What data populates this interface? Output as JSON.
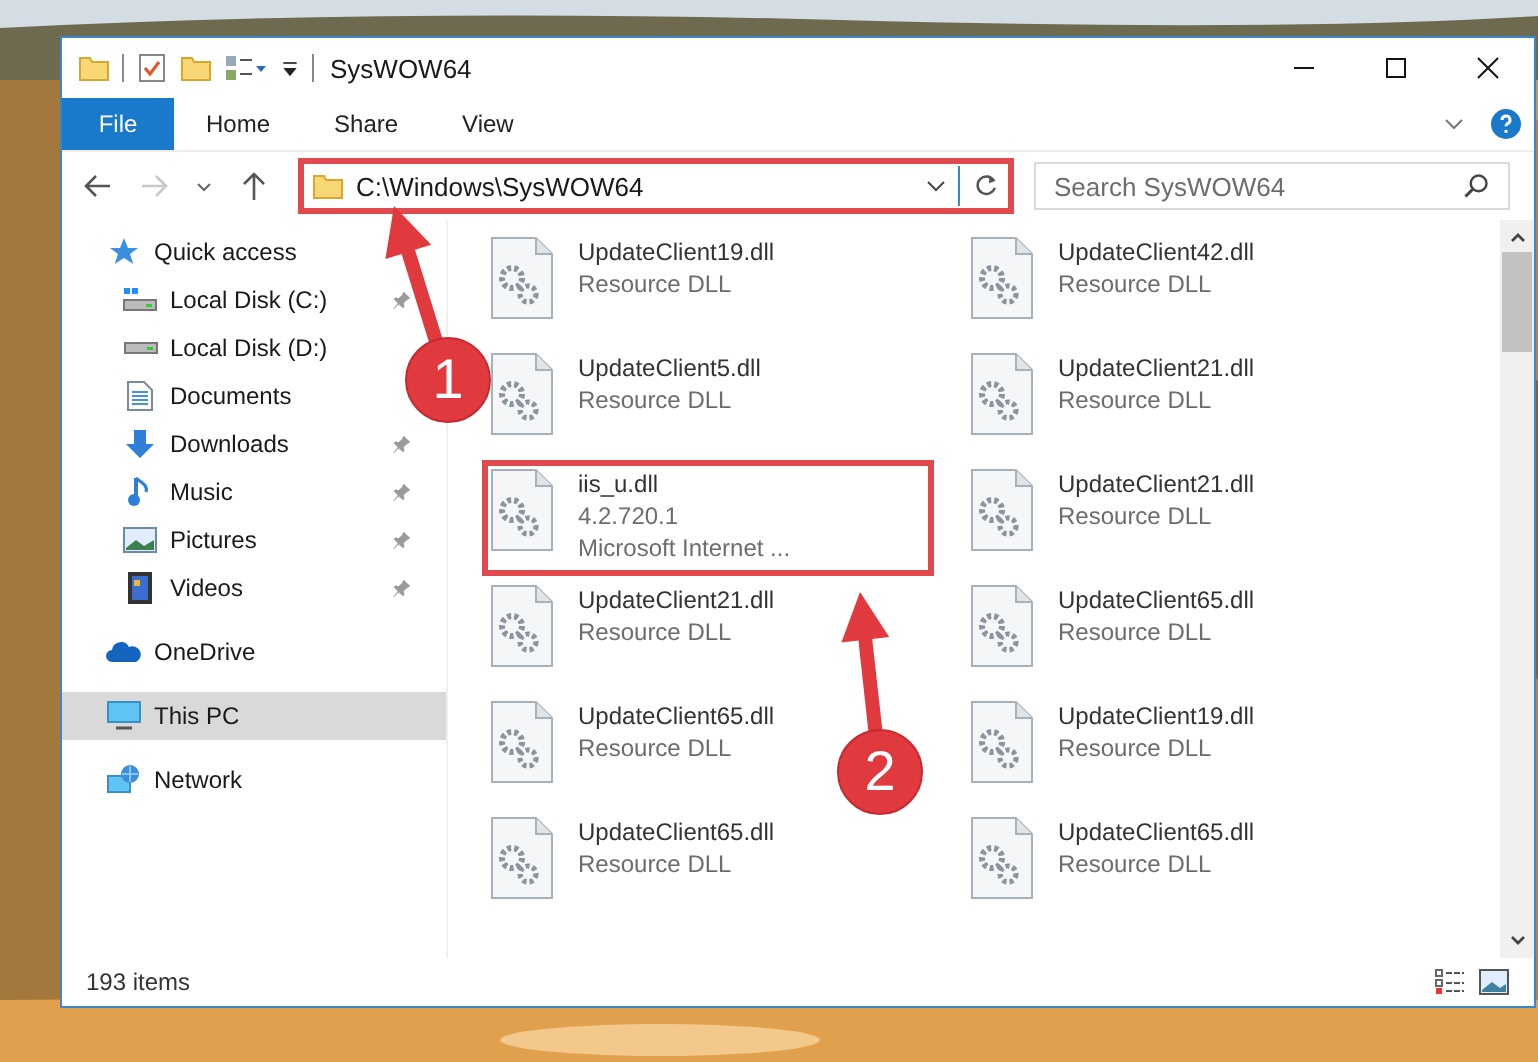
{
  "window": {
    "title": "SysWOW64"
  },
  "ribbon_tabs": [
    {
      "label": "File",
      "kind": "file"
    },
    {
      "label": "Home",
      "kind": "tab"
    },
    {
      "label": "Share",
      "kind": "tab"
    },
    {
      "label": "View",
      "kind": "tab"
    }
  ],
  "address_bar": {
    "path": "C:\\Windows\\SysWOW64",
    "highlighted": true
  },
  "search": {
    "placeholder": "Search SysWOW64"
  },
  "sidebar": {
    "items": [
      {
        "label": "Quick access",
        "selected": false,
        "children": [
          {
            "label": "Local Disk (C:)",
            "pinned": true
          },
          {
            "label": "Local Disk (D:)",
            "pinned": false
          },
          {
            "label": "Documents",
            "pinned": false
          },
          {
            "label": "Downloads",
            "pinned": true
          },
          {
            "label": "Music",
            "pinned": true
          },
          {
            "label": "Pictures",
            "pinned": true
          },
          {
            "label": "Videos",
            "pinned": true
          }
        ]
      },
      {
        "label": "OneDrive",
        "selected": false
      },
      {
        "label": "This PC",
        "selected": true
      },
      {
        "label": "Network",
        "selected": false
      }
    ]
  },
  "files": [
    {
      "name": "UpdateClient19.dll",
      "lines": [
        "Resource DLL"
      ],
      "highlighted": false
    },
    {
      "name": "UpdateClient42.dll",
      "lines": [
        "Resource DLL"
      ],
      "highlighted": false
    },
    {
      "name": "UpdateClient5.dll",
      "lines": [
        "Resource DLL"
      ],
      "highlighted": false
    },
    {
      "name": "UpdateClient21.dll",
      "lines": [
        "Resource DLL"
      ],
      "highlighted": false
    },
    {
      "name": "iis_u.dll",
      "lines": [
        "4.2.720.1",
        "Microsoft Internet ..."
      ],
      "highlighted": true
    },
    {
      "name": "UpdateClient21.dll",
      "lines": [
        "Resource DLL"
      ],
      "highlighted": false
    },
    {
      "name": "UpdateClient21.dll",
      "lines": [
        "Resource DLL"
      ],
      "highlighted": false
    },
    {
      "name": "UpdateClient65.dll",
      "lines": [
        "Resource DLL"
      ],
      "highlighted": false
    },
    {
      "name": "UpdateClient65.dll",
      "lines": [
        "Resource DLL"
      ],
      "highlighted": false
    },
    {
      "name": "UpdateClient19.dll",
      "lines": [
        "Resource DLL"
      ],
      "highlighted": false
    },
    {
      "name": "UpdateClient65.dll",
      "lines": [
        "Resource DLL"
      ],
      "highlighted": false
    },
    {
      "name": "UpdateClient65.dll",
      "lines": [
        "Resource DLL"
      ],
      "highlighted": false
    }
  ],
  "status_bar": {
    "count": "193 items"
  },
  "annotations": [
    {
      "number": "1"
    },
    {
      "number": "2"
    }
  ]
}
